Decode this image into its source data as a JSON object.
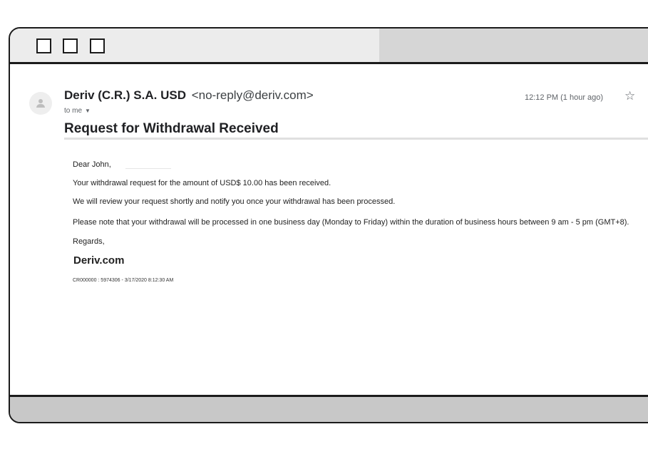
{
  "window": {
    "controls": [
      "square-button",
      "square-button",
      "square-button"
    ]
  },
  "email": {
    "sender_name": "Deriv (C.R.) S.A. USD",
    "sender_email": "<no-reply@deriv.com>",
    "recipient": "to me",
    "timestamp": "12:12 PM (1 hour ago)",
    "star_icon": "star-outline-icon",
    "subject": "Request for Withdrawal Received",
    "body": {
      "greeting": "Dear  John,",
      "line1": "Your withdrawal request for the amount of USD$ 10.00 has been received.",
      "line2": "We will review your request shortly and notify you once your withdrawal has been processed.",
      "line3": "Please note that your withdrawal will be processed in one business day (Monday to Friday) within the duration of business hours between 9 am - 5 pm (GMT+8).",
      "regards": "Regards,",
      "signature": "Deriv.com",
      "reference": "CR000000 : 5974306 - 3/17/2020 8:12:30 AM"
    }
  },
  "colors": {
    "frame": "#1b1b1b",
    "titlebar": "#ececec",
    "titlebar_right": "#d6d6d6",
    "footer": "#c8c8c8",
    "text_primary": "#202124",
    "text_secondary": "#5f6368"
  }
}
